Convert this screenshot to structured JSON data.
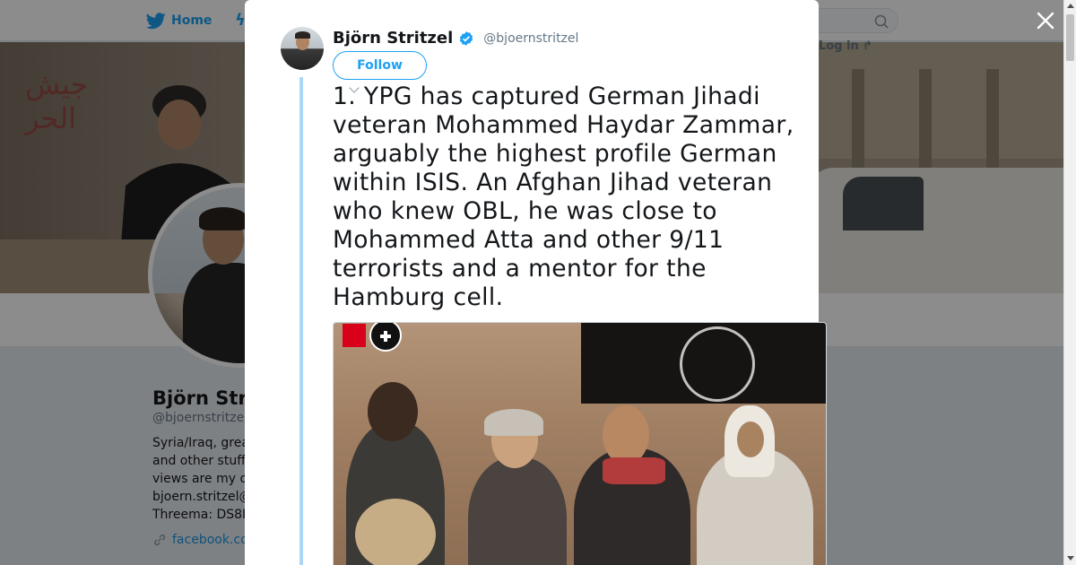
{
  "nav": {
    "home_label": "Home",
    "login_label": "Log in"
  },
  "profile": {
    "name": "Björn Str",
    "handle": "@bjoernstritze",
    "bio_lines": [
      "Syria/Iraq, grea",
      "and other stuff",
      "views are my o",
      "bjoern.stritzel@",
      "Threema: DS8I"
    ],
    "link_text": "facebook.co"
  },
  "tweet": {
    "author_name": "Björn Stritzel",
    "author_handle": "@bjoernstritzel",
    "verified": true,
    "follow_label": "Follow",
    "text": "1. YPG has captured German Jihadi veteran Mohammed Haydar Zammar, arguably the highest profile German within ISIS. An Afghan Jihad veteran who knew OBL, he was close to Mohammed Atta and other 9/11 terrorists and a mentor for the Hamburg cell.",
    "media_logo": "Bild"
  },
  "icons": {
    "home": "twitter-bird-icon",
    "search": "search-icon",
    "close": "close-icon",
    "verified": "verified-badge-icon",
    "link": "link-icon",
    "plus": "plus-icon"
  },
  "colors": {
    "brand": "#1da1f2",
    "thread_line": "#aad7f7",
    "text": "#14171a",
    "muted": "#657786"
  }
}
